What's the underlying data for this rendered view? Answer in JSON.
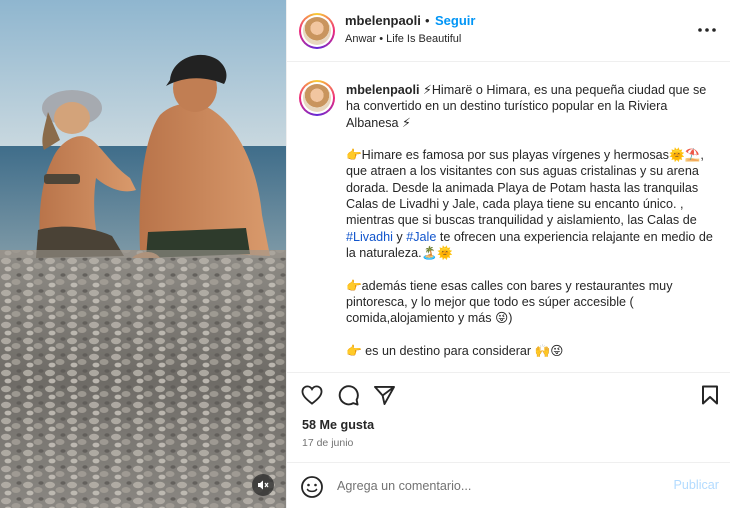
{
  "photo": {
    "description_icon": "mute-icon"
  },
  "header": {
    "username": "mbelenpaoli",
    "separator": "•",
    "follow_label": "Seguir",
    "subline": "Anwar • Life Is Beautiful",
    "more_icon": "more-horizontal-icon"
  },
  "caption": {
    "username": "mbelenpaoli",
    "p1": " ⚡Himarë o Himara, es una pequeña ciudad que se ha convertido en un destino turístico popular en la Riviera Albanesa ⚡",
    "p2a": "👉Himare es famosa por sus playas vírgenes y hermosas🌞⛱️, que atraen a los visitantes con sus aguas cristalinas y su arena dorada. Desde la animada Playa de Potam hasta las tranquilas Calas de Livadhi y Jale, cada playa tiene su encanto único. , mientras que si buscas tranquilidad y aislamiento, las Calas de ",
    "hashtag1": "#Livadhi",
    "p2b": " y ",
    "hashtag2": "#Jale",
    "p2c": " te ofrecen una experiencia relajante en medio de la naturaleza.🏝️🌞",
    "p3": "👉además tiene esas calles con bares y restaurantes muy pintoresca, y lo mejor que todo es súper accesible ( comida,alojamiento y más 😜)",
    "p4": "👉 es un destino para considerar 🙌😜"
  },
  "actions": {
    "like_icon": "heart-icon",
    "comment_icon": "comment-icon",
    "share_icon": "send-icon",
    "save_icon": "bookmark-icon"
  },
  "likes": "58 Me gusta",
  "date": "17 de junio",
  "comment": {
    "emoji_icon": "emoji-icon",
    "placeholder": "Agrega un comentario...",
    "publish_label": "Publicar"
  },
  "colors": {
    "accent": "#0095f6",
    "publish_disabled": "#b3dbff",
    "text": "#262626",
    "muted": "#737373"
  }
}
